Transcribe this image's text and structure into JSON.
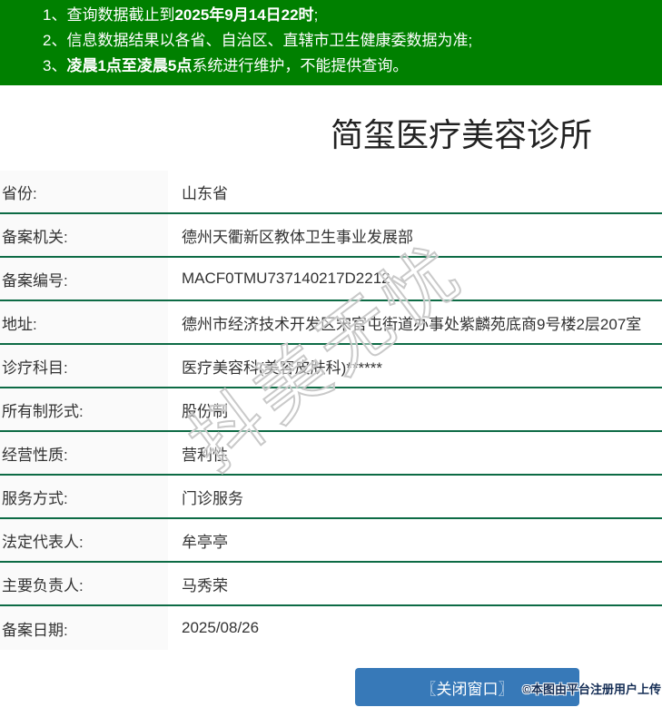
{
  "notice_bar": {
    "bg_color": "#008000",
    "items": [
      {
        "num": "1、",
        "pre": "查询数据截止到",
        "bold": "2025年9月14日22时",
        "post": ";"
      },
      {
        "num": "2、",
        "pre": "信息数据结果以各省、自治区、直辖市卫生健康委数据为准;",
        "bold": "",
        "post": ""
      },
      {
        "num": "3、",
        "pre": "",
        "bold": "凌晨1点至凌晨5点",
        "post": "系统进行维护，不能提供查询。"
      }
    ]
  },
  "title": "简玺医疗美容诊所",
  "table": {
    "label_bg": "#fafafa",
    "border_color": "#0d6b45",
    "rows": [
      {
        "label": "省份:",
        "value": "山东省"
      },
      {
        "label": "备案机关:",
        "value": "德州天衢新区教体卫生事业发展部"
      },
      {
        "label": "备案编号:",
        "value": "MACF0TMU737140217D2212"
      },
      {
        "label": "地址:",
        "value": "德州市经济技术开发区宋官屯街道办事处紫麟苑底商9号楼2层207室"
      },
      {
        "label": "诊疗科目:",
        "value": "医疗美容科(美容皮肤科)******"
      },
      {
        "label": "所有制形式:",
        "value": "股份制"
      },
      {
        "label": "经营性质:",
        "value": "营利性"
      },
      {
        "label": "服务方式:",
        "value": "门诊服务"
      },
      {
        "label": "法定代表人:",
        "value": "牟亭亭"
      },
      {
        "label": "主要负责人:",
        "value": "马秀荣"
      },
      {
        "label": "备案日期:",
        "value": "2025/08/26"
      }
    ]
  },
  "watermark": "抖美无忧",
  "footer": {
    "close_button": "〖关闭窗口〗",
    "button_color": "#3779b8",
    "copyright": "©本图由平台注册用户上传",
    "copyright_color": "#132c54"
  }
}
